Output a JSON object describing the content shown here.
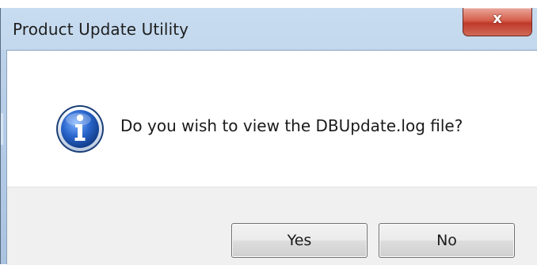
{
  "window": {
    "title": "Product Update Utility",
    "close_glyph": "x"
  },
  "message": {
    "icon": "info-icon",
    "text": "Do you wish to view the DBUpdate.log file?"
  },
  "buttons": {
    "yes_label": "Yes",
    "no_label": "No"
  },
  "colors": {
    "titlebar": "#c8dcf0",
    "close_button": "#c0392b",
    "info_icon": "#1e5bb8",
    "button_panel": "#f0f0f0"
  }
}
